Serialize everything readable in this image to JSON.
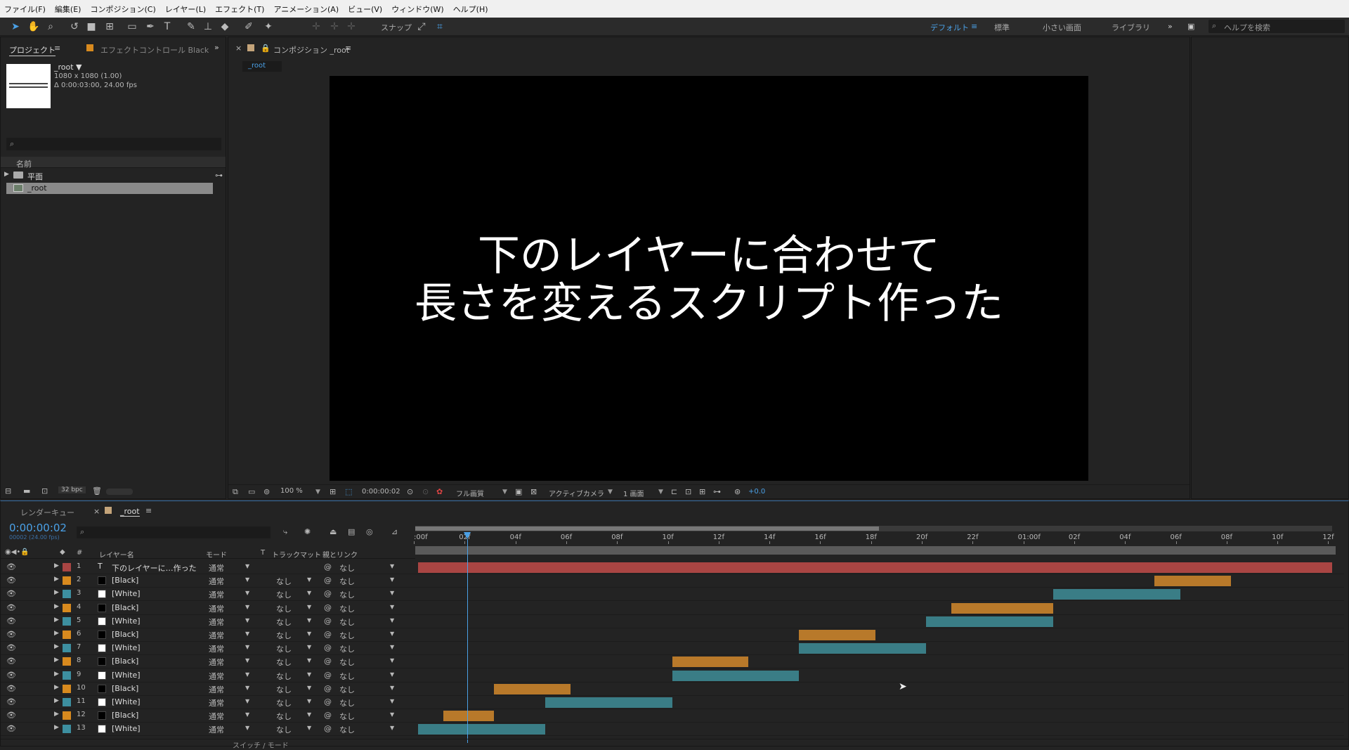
{
  "menu": [
    "ファイル(F)",
    "編集(E)",
    "コンポジション(C)",
    "レイヤー(L)",
    "エフェクト(T)",
    "アニメーション(A)",
    "ビュー(V)",
    "ウィンドウ(W)",
    "ヘルプ(H)"
  ],
  "toolbar": {
    "snap_label": "スナップ",
    "workspaces": [
      "デフォルト",
      "標準",
      "小さい画面",
      "ライブラリ"
    ],
    "search_placeholder": "ヘルプを検索"
  },
  "project": {
    "tab": "プロジェクト",
    "effect_tab": "エフェクトコントロール Black",
    "item_name": "_root ▼",
    "item_info": "1080 x 1080 (1.00)",
    "item_duration": "Δ 0:00:03:00, 24.00 fps",
    "column_name": "名前",
    "rows": [
      "平面",
      "_root"
    ],
    "bpc": "32 bpc"
  },
  "comp": {
    "tab": "コンポジション _root",
    "breadcrumb": "_root",
    "text_line1": "下のレイヤーに合わせて",
    "text_line2": "長さを変えるスクリプト作った",
    "zoom": "100 %",
    "timecode": "0:00:00:02",
    "quality": "フル画質",
    "camera": "アクティブカメラ",
    "views": "1 画面",
    "exposure": "+0.0"
  },
  "timeline": {
    "render_tab": "レンダーキュー",
    "comp_tab": "_root",
    "timecode": "0:00:00:02",
    "sub_timecode": "00002 (24.00 fps)",
    "col_num": "#",
    "col_layer": "レイヤー名",
    "col_mode": "モード",
    "col_t": "T",
    "col_track": "トラックマット",
    "col_parent": "親とリンク",
    "footer": "スイッチ / モード",
    "ruler": [
      ":00f",
      "02f",
      "04f",
      "06f",
      "08f",
      "10f",
      "12f",
      "14f",
      "16f",
      "18f",
      "20f",
      "22f",
      "01:00f",
      "02f",
      "04f",
      "06f",
      "08f",
      "10f",
      "12f"
    ],
    "layers": [
      {
        "num": "1",
        "name": "下のレイヤーに…作った",
        "mode": "通常",
        "track": "",
        "parent": "なし",
        "label": "#a94543",
        "swatch": "text"
      },
      {
        "num": "2",
        "name": "[Black]",
        "mode": "通常",
        "track": "なし",
        "parent": "なし",
        "label": "#d88a1e",
        "swatch": "#000000"
      },
      {
        "num": "3",
        "name": "[White]",
        "mode": "通常",
        "track": "なし",
        "parent": "なし",
        "label": "#3d8fa0",
        "swatch": "#ffffff"
      },
      {
        "num": "4",
        "name": "[Black]",
        "mode": "通常",
        "track": "なし",
        "parent": "なし",
        "label": "#d88a1e",
        "swatch": "#000000"
      },
      {
        "num": "5",
        "name": "[White]",
        "mode": "通常",
        "track": "なし",
        "parent": "なし",
        "label": "#3d8fa0",
        "swatch": "#ffffff"
      },
      {
        "num": "6",
        "name": "[Black]",
        "mode": "通常",
        "track": "なし",
        "parent": "なし",
        "label": "#d88a1e",
        "swatch": "#000000"
      },
      {
        "num": "7",
        "name": "[White]",
        "mode": "通常",
        "track": "なし",
        "parent": "なし",
        "label": "#3d8fa0",
        "swatch": "#ffffff"
      },
      {
        "num": "8",
        "name": "[Black]",
        "mode": "通常",
        "track": "なし",
        "parent": "なし",
        "label": "#d88a1e",
        "swatch": "#000000"
      },
      {
        "num": "9",
        "name": "[White]",
        "mode": "通常",
        "track": "なし",
        "parent": "なし",
        "label": "#3d8fa0",
        "swatch": "#ffffff"
      },
      {
        "num": "10",
        "name": "[Black]",
        "mode": "通常",
        "track": "なし",
        "parent": "なし",
        "label": "#d88a1e",
        "swatch": "#000000"
      },
      {
        "num": "11",
        "name": "[White]",
        "mode": "通常",
        "track": "なし",
        "parent": "なし",
        "label": "#3d8fa0",
        "swatch": "#ffffff"
      },
      {
        "num": "12",
        "name": "[Black]",
        "mode": "通常",
        "track": "なし",
        "parent": "なし",
        "label": "#d88a1e",
        "swatch": "#000000"
      },
      {
        "num": "13",
        "name": "[White]",
        "mode": "通常",
        "track": "なし",
        "parent": "なし",
        "label": "#3d8fa0",
        "swatch": "#ffffff"
      }
    ],
    "bars": [
      [
        0,
        36
      ],
      [
        29,
        32
      ],
      [
        25,
        30
      ],
      [
        21,
        25
      ],
      [
        20,
        25
      ],
      [
        15,
        18
      ],
      [
        15,
        20
      ],
      [
        10,
        13
      ],
      [
        10,
        15
      ],
      [
        3,
        6
      ],
      [
        5,
        10
      ],
      [
        1,
        3
      ],
      [
        0,
        5
      ]
    ]
  }
}
